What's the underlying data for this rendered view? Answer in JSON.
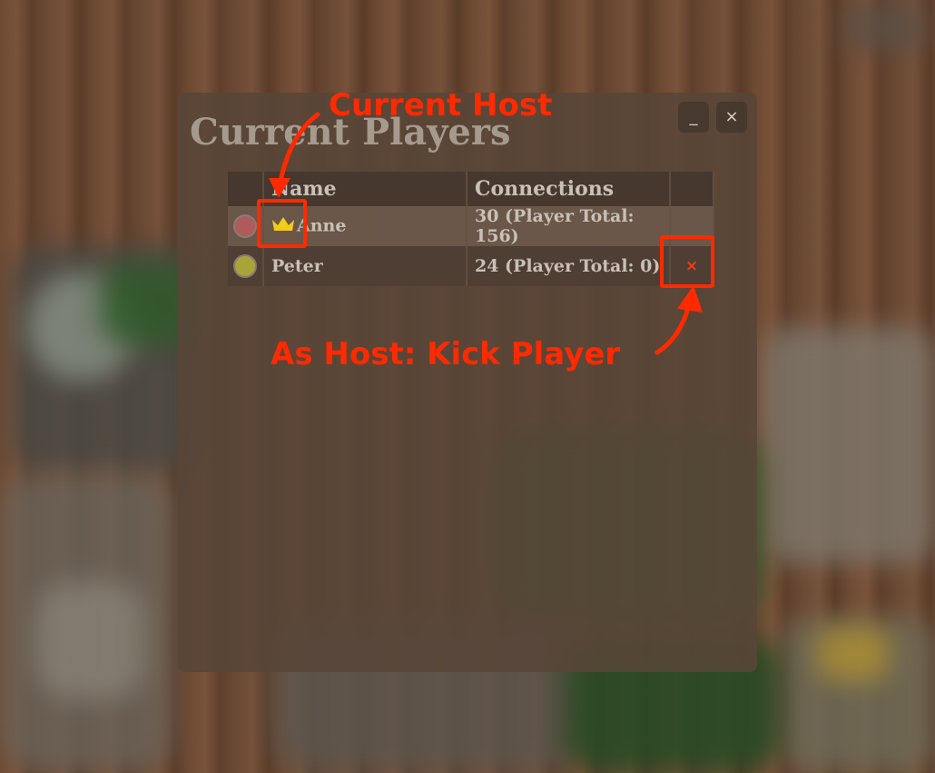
{
  "dialog": {
    "title": "Current Players",
    "minimize_label": "_",
    "close_label": "×"
  },
  "table": {
    "headers": [
      "Name",
      "Connections"
    ],
    "rows": [
      {
        "name": "Anne",
        "connections": "30 (Player Total: 156)",
        "color": "#b05a5e",
        "is_host": true,
        "icon": "crown-icon"
      },
      {
        "name": "Peter",
        "connections": "24 (Player Total: 0)",
        "color": "#a9a43a",
        "is_host": false,
        "kick_label": "×"
      }
    ]
  },
  "annotations": {
    "host_label": "Current Host",
    "kick_label": "As Host: Kick Player",
    "color": "#ff2a00"
  },
  "colors": {
    "crown": "#f2cc1a",
    "kick": "#f03a1e"
  }
}
